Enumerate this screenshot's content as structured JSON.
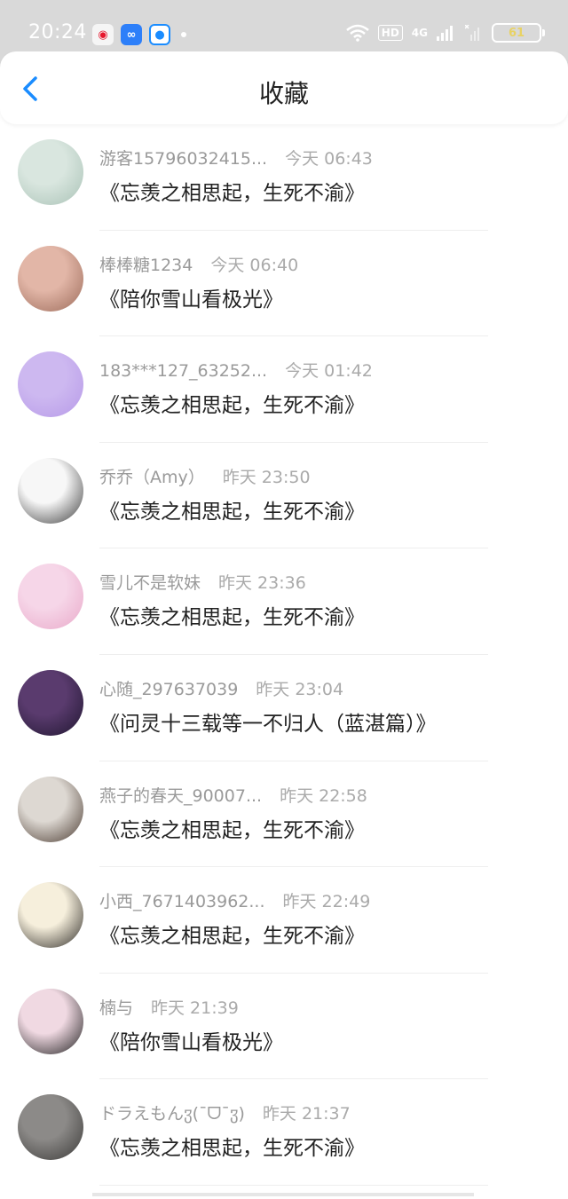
{
  "status_bar": {
    "time": "20:24",
    "network": "4G",
    "hd": "HD",
    "battery": "61"
  },
  "header": {
    "title": "收藏"
  },
  "items": [
    {
      "name": "游客15796032415...",
      "stamp": "今天 06:43",
      "work": "《忘羡之相思起，生死不渝》",
      "avatar_colors": [
        "#d9e6df",
        "#a9c2b6"
      ]
    },
    {
      "name": "棒棒糖1234",
      "stamp": "今天 06:40",
      "work": "《陪你雪山看极光》",
      "avatar_colors": [
        "#e2b6a7",
        "#9b6a59"
      ]
    },
    {
      "name": "183***127_63252...",
      "stamp": "今天 01:42",
      "work": "《忘羡之相思起，生死不渝》",
      "avatar_colors": [
        "#cdb8f0",
        "#b79ae8"
      ]
    },
    {
      "name": "乔乔（Amy）",
      "stamp": "昨天 23:50",
      "work": "《忘羡之相思起，生死不渝》",
      "avatar_colors": [
        "#f7f7f7",
        "#3b3b3b"
      ]
    },
    {
      "name": "雪儿不是软妹",
      "stamp": "昨天 23:36",
      "work": "《忘羡之相思起，生死不渝》",
      "avatar_colors": [
        "#f6d6e8",
        "#e9a9c9"
      ]
    },
    {
      "name": "心随_297637039",
      "stamp": "昨天 23:04",
      "work": "《问灵十三载等一不归人（蓝湛篇）》",
      "avatar_colors": [
        "#5a3b6e",
        "#1f1630"
      ]
    },
    {
      "name": "燕子的春天_90007...",
      "stamp": "昨天 22:58",
      "work": "《忘羡之相思起，生死不渝》",
      "avatar_colors": [
        "#ddd8d2",
        "#4a3a30"
      ]
    },
    {
      "name": "小西_7671403962...",
      "stamp": "昨天 22:49",
      "work": "《忘羡之相思起，生死不渝》",
      "avatar_colors": [
        "#f6efdc",
        "#2d2a26"
      ]
    },
    {
      "name": "楠与",
      "stamp": "昨天 21:39",
      "work": "《陪你雪山看极光》",
      "avatar_colors": [
        "#f0d9e2",
        "#1e1e1e"
      ]
    },
    {
      "name": "ドラえもんჳ(¯ᗜ¯ჳ)",
      "stamp": "昨天 21:37",
      "work": "《忘羡之相思起，生死不渝》",
      "avatar_colors": [
        "#8c8a88",
        "#3a3937"
      ]
    }
  ],
  "colors": {
    "accent": "#1a8cff",
    "status_bar_bg": "#d9d9d9",
    "meta_text": "#9a9a9a"
  },
  "icons": {
    "back": "chevron-left-icon",
    "wifi": "wifi-icon",
    "signal": "signal-icon",
    "battery": "battery-icon"
  }
}
